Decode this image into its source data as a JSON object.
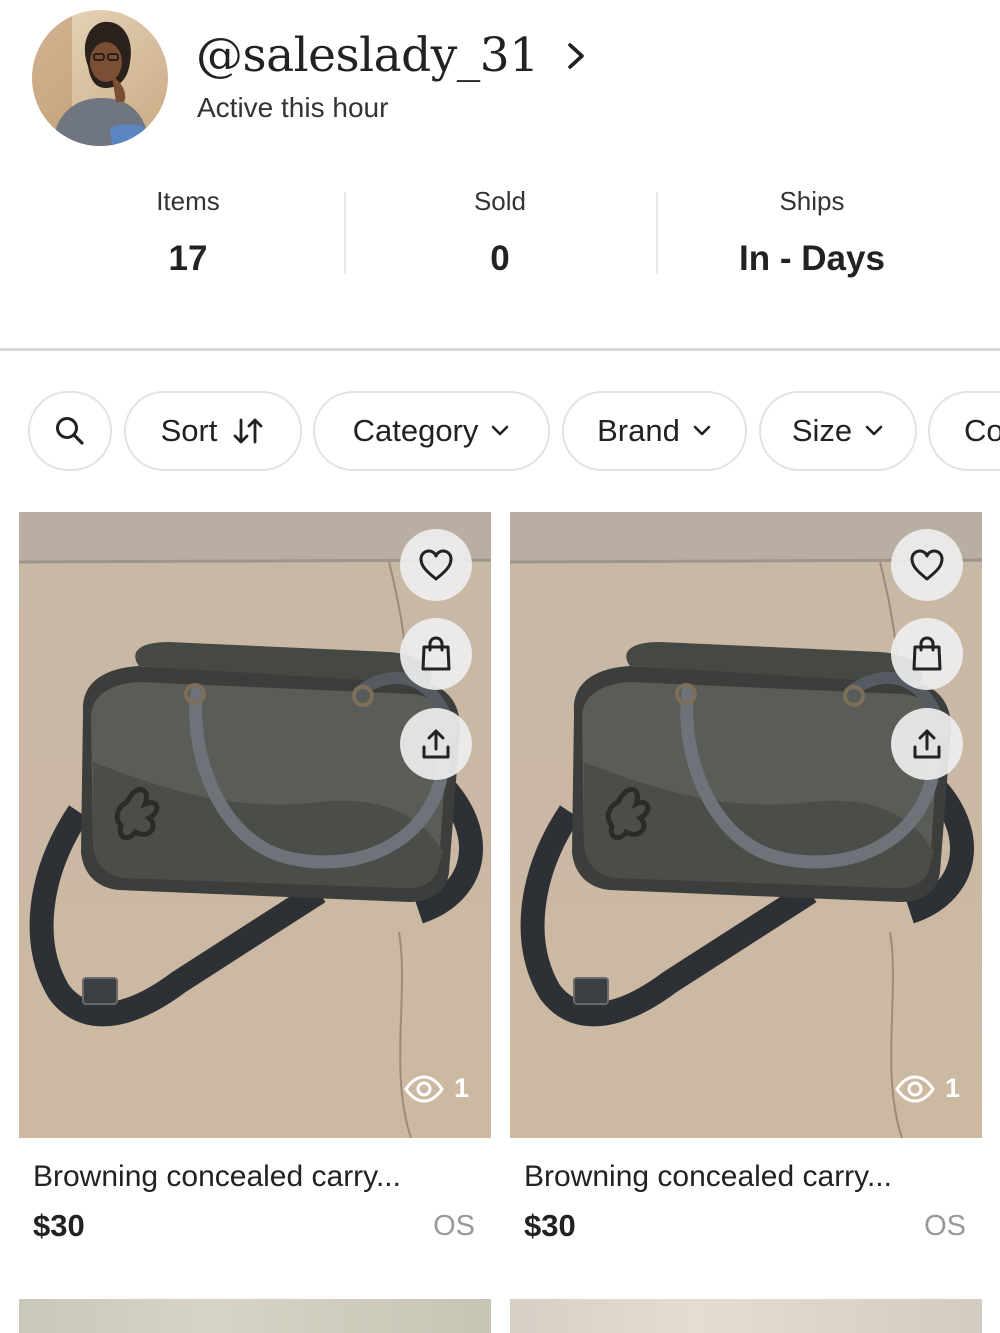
{
  "profile": {
    "username": "@saleslady_31",
    "status": "Active this hour"
  },
  "stats": [
    {
      "label": "Items",
      "value": "17"
    },
    {
      "label": "Sold",
      "value": "0"
    },
    {
      "label": "Ships",
      "value": "In - Days"
    }
  ],
  "filters": {
    "sort": "Sort",
    "category": "Category",
    "brand": "Brand",
    "size": "Size",
    "partial": "Co"
  },
  "listings": [
    {
      "title": "Browning concealed carry...",
      "price": "$30",
      "size": "OS",
      "views": "1"
    },
    {
      "title": "Browning concealed carry...",
      "price": "$30",
      "size": "OS",
      "views": "1"
    }
  ],
  "icons": {
    "profile": "chevron-right-icon",
    "search": "search-icon",
    "sort": "sort-arrows-icon",
    "dropdown": "chevron-down-icon",
    "like": "heart-icon",
    "bag": "shopping-bag-icon",
    "share": "share-icon",
    "views": "eye-icon"
  }
}
